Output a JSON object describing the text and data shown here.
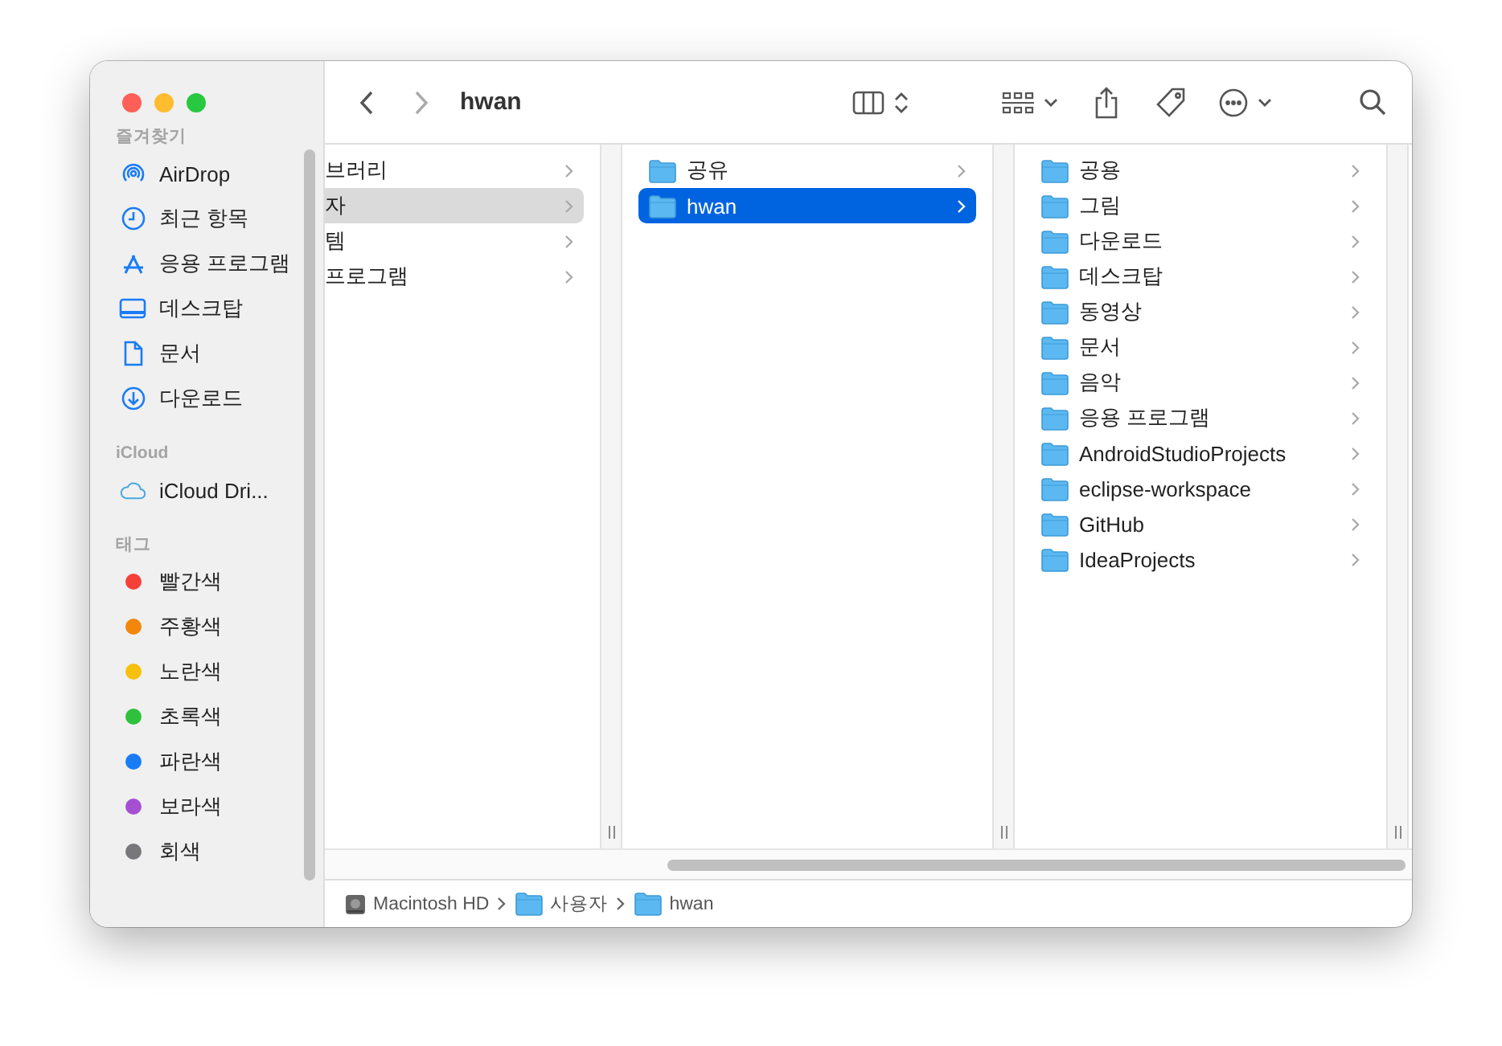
{
  "window": {
    "title": "hwan"
  },
  "sidebar": {
    "sections": [
      {
        "heading": "즐겨찾기",
        "items": [
          {
            "kind": "airdrop",
            "label": "AirDrop"
          },
          {
            "kind": "recent",
            "label": "최근 항목"
          },
          {
            "kind": "apps",
            "label": "응용 프로그램"
          },
          {
            "kind": "desktop",
            "label": "데스크탑"
          },
          {
            "kind": "document",
            "label": "문서"
          },
          {
            "kind": "download",
            "label": "다운로드"
          }
        ]
      },
      {
        "heading": "iCloud",
        "items": [
          {
            "kind": "cloud",
            "label": "iCloud Dri..."
          }
        ]
      },
      {
        "heading": "태그",
        "items": [
          {
            "kind": "tag",
            "label": "빨간색",
            "color": "#f5403a"
          },
          {
            "kind": "tag",
            "label": "주황색",
            "color": "#f2870b"
          },
          {
            "kind": "tag",
            "label": "노란색",
            "color": "#f5c10d"
          },
          {
            "kind": "tag",
            "label": "초록색",
            "color": "#2fc13d"
          },
          {
            "kind": "tag",
            "label": "파란색",
            "color": "#1a7cf5"
          },
          {
            "kind": "tag",
            "label": "보라색",
            "color": "#a550d3"
          },
          {
            "kind": "tag",
            "label": "회색",
            "color": "#78787c"
          }
        ]
      }
    ]
  },
  "columns": [
    {
      "items": [
        {
          "name": "브러리",
          "folder": false,
          "selected": false
        },
        {
          "name": "자",
          "folder": false,
          "selected": true
        },
        {
          "name": "템",
          "folder": false,
          "selected": false
        },
        {
          "name": "프로그램",
          "folder": false,
          "selected": false
        }
      ]
    },
    {
      "items": [
        {
          "name": "공유",
          "folder": true,
          "selected": false
        },
        {
          "name": "hwan",
          "folder": true,
          "selected": true
        }
      ]
    },
    {
      "items": [
        {
          "name": "공용",
          "folder": true,
          "selected": false
        },
        {
          "name": "그림",
          "folder": true,
          "selected": false
        },
        {
          "name": "다운로드",
          "folder": true,
          "selected": false
        },
        {
          "name": "데스크탑",
          "folder": true,
          "selected": false
        },
        {
          "name": "동영상",
          "folder": true,
          "selected": false
        },
        {
          "name": "문서",
          "folder": true,
          "selected": false
        },
        {
          "name": "음악",
          "folder": true,
          "selected": false
        },
        {
          "name": "응용 프로그램",
          "folder": true,
          "selected": false
        },
        {
          "name": "AndroidStudioProjects",
          "folder": true,
          "selected": false
        },
        {
          "name": "eclipse-workspace",
          "folder": true,
          "selected": false
        },
        {
          "name": "GitHub",
          "folder": true,
          "selected": false
        },
        {
          "name": "IdeaProjects",
          "folder": true,
          "selected": false
        }
      ]
    }
  ],
  "path_bar": [
    {
      "kind": "disk",
      "label": "Macintosh HD"
    },
    {
      "kind": "folder",
      "label": "사용자"
    },
    {
      "kind": "folder",
      "label": "hwan"
    }
  ]
}
